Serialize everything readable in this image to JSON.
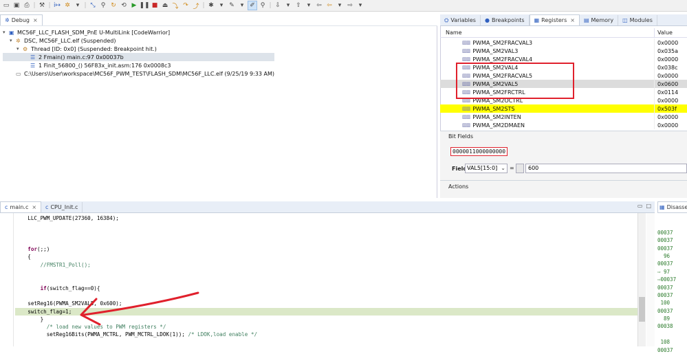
{
  "toolbar": {
    "icons": [
      "new-icon",
      "save-icon",
      "print-icon",
      "build-icon",
      "debug-config-icon",
      "skip-breakpoints-icon",
      "resume-icon",
      "suspend-icon",
      "terminate-icon",
      "disconnect-icon",
      "step-into-icon",
      "step-over-icon",
      "step-return-icon",
      "instruction-step-icon",
      "search-icon",
      "highlight-icon",
      "next-annotation-icon",
      "prev-annotation-icon",
      "back-icon",
      "forward-icon"
    ]
  },
  "debug_view": {
    "tab_label": "Debug",
    "tree": [
      {
        "label": "MC56F_LLC_FLASH_SDM_PnE U-MultiLink [CodeWarrior]",
        "indent": 0,
        "icon": "launch-icon",
        "expander": "▾"
      },
      {
        "label": "DSC, MC56F_LLC.elf (Suspended)",
        "indent": 1,
        "icon": "target-icon",
        "expander": "▾"
      },
      {
        "label": "Thread [ID: 0x0] (Suspended: Breakpoint hit.)",
        "indent": 2,
        "icon": "thread-icon",
        "expander": "▾"
      },
      {
        "label": "2 Fmain() main.c:97 0x00037b",
        "indent": 3,
        "icon": "stack-frame-icon",
        "expander": "",
        "selected": true
      },
      {
        "label": "1 Finit_56800_() 56F83x_init.asm:176 0x0008c3",
        "indent": 3,
        "icon": "stack-frame-icon",
        "expander": ""
      },
      {
        "label": "C:\\Users\\User\\workspace\\MC56F_PWM_TEST\\FLASH_SDM\\MC56F_LLC.elf (9/25/19 9:33 AM)",
        "indent": 1,
        "icon": "process-icon",
        "expander": ""
      }
    ]
  },
  "right_tabs": [
    {
      "label": "Variables",
      "icon": "variables-icon"
    },
    {
      "label": "Breakpoints",
      "icon": "breakpoints-icon"
    },
    {
      "label": "Registers",
      "icon": "registers-icon",
      "active": true,
      "close": "×"
    },
    {
      "label": "Memory",
      "icon": "memory-icon"
    },
    {
      "label": "Modules",
      "icon": "modules-icon"
    }
  ],
  "registers": {
    "col_name": "Name",
    "col_value": "Value",
    "rows": [
      {
        "name": "PWMA_SM2FRACVAL3",
        "value": "0x0000",
        "style": ""
      },
      {
        "name": "PWMA_SM2VAL3",
        "value": "0x035a",
        "style": ""
      },
      {
        "name": "PWMA_SM2FRACVAL4",
        "value": "0x0000",
        "style": ""
      },
      {
        "name": "PWMA_SM2VAL4",
        "value": "0x038c",
        "style": ""
      },
      {
        "name": "PWMA_SM2FRACVAL5",
        "value": "0x0000",
        "style": ""
      },
      {
        "name": "PWMA_SM2VAL5",
        "value": "0x0600",
        "style": "grey"
      },
      {
        "name": "PWMA_SM2FRCTRL",
        "value": "0x0114",
        "style": ""
      },
      {
        "name": "PWMA_SM2OCTRL",
        "value": "0x0000",
        "style": ""
      },
      {
        "name": "PWMA_SM2STS",
        "value": "0x503f",
        "style": "yellow"
      },
      {
        "name": "PWMA_SM2INTEN",
        "value": "0x0000",
        "style": ""
      },
      {
        "name": "PWMA_SM2DMAEN",
        "value": "0x0000",
        "style": ""
      }
    ],
    "bit_fields": {
      "title": "Bit Fields",
      "bits": "0000011000000000",
      "field_label": "Field",
      "field_select": "VAL5[15:0]",
      "equals": "=",
      "field_value": "600"
    },
    "actions_title": "Actions"
  },
  "editor": {
    "tabs": [
      {
        "label": "main.c",
        "active": true,
        "close": "×"
      },
      {
        "label": "CPU_Init.c",
        "active": false
      }
    ],
    "lines": [
      {
        "text": "    LLC_PWM_UPDATE(27360, 16384);"
      },
      {
        "text": ""
      },
      {
        "text": ""
      },
      {
        "text": ""
      },
      {
        "text": "    for(;;)"
      },
      {
        "text": "    {"
      },
      {
        "text": "        //FMSTR1_Poll();"
      },
      {
        "text": ""
      },
      {
        "text": ""
      },
      {
        "text": "        if(switch_flag==0){"
      },
      {
        "text": ""
      },
      {
        "text": "    setReg16(PWMA_SM2VAL5, 0x600);"
      },
      {
        "text": "    switch_flag=1;",
        "highlight": true
      },
      {
        "text": "        }"
      },
      {
        "text": "          /* load new values to PWM registers */"
      },
      {
        "text": "          setReg16Bits(PWMA_MCTRL, PWM_MCTRL_LDOK(1)); /* LDOK,load enable */"
      }
    ]
  },
  "disassembly": {
    "tab_label": "Disasse",
    "lines": [
      "",
      "",
      "00037",
      "00037",
      "00037",
      "  96",
      "00037",
      "⇨ 97",
      "⇨00037",
      "00037",
      "00037",
      " 100",
      "00037",
      "  89",
      "00038",
      "",
      " 108",
      "00037"
    ]
  },
  "annotation_color": "#e0202c",
  "highlight_color": "#ffff00"
}
